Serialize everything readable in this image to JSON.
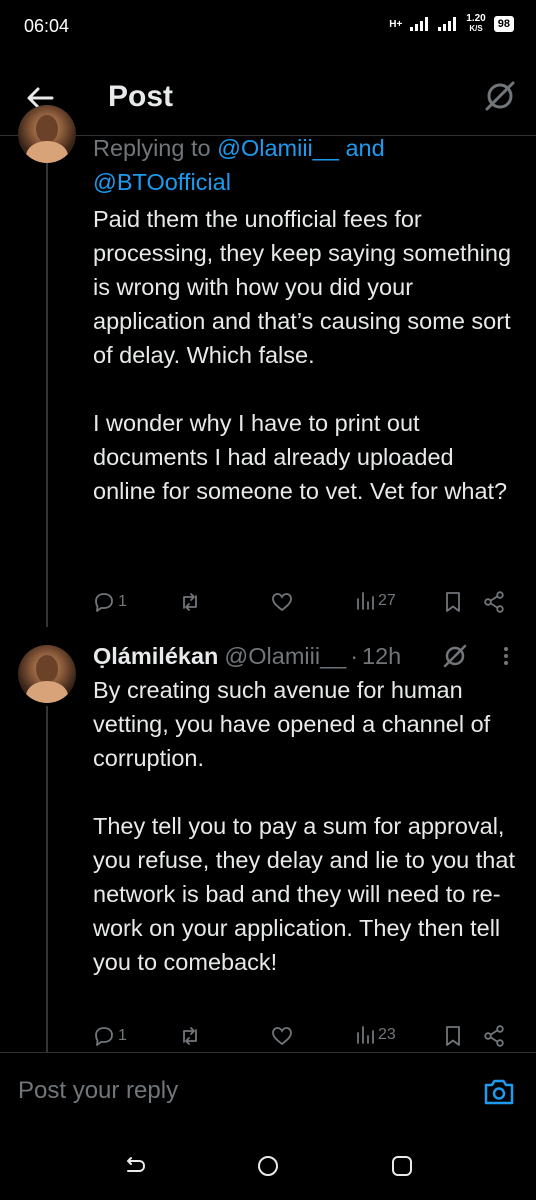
{
  "status_bar": {
    "time": "06:04",
    "network": "H+",
    "net_speed_value": "1.20",
    "net_speed_unit": "K/S",
    "battery": "98"
  },
  "header": {
    "title": "Post",
    "back_icon": "arrow-left-icon",
    "grok_icon": "grok-icon"
  },
  "post1": {
    "reply_to_prefix": "Replying to ",
    "reply_to_user1": "@Olamiii__",
    "reply_to_and": " and",
    "reply_to_user2": "@BTOofficial",
    "text": "Paid them the unofficial fees for processing, they keep saying something is wrong with how you did your application and that’s causing some sort of delay. Which false.\n\nI wonder why I have to print out documents I had already uploaded online for someone to vet. Vet for what?",
    "replies": "1",
    "reposts": "",
    "likes": "",
    "views": "27"
  },
  "post2": {
    "display_name": "Ọlámilékan",
    "handle": "@Olamiii__",
    "separator": "·",
    "time": "12h",
    "text": "By creating such avenue for human vetting, you have opened a channel of corruption.\n\nThey tell you to pay a sum for approval, you refuse, they delay and lie to you that network is bad and they will need to re-work on your application. They then tell you to comeback!",
    "replies": "1",
    "reposts": "",
    "likes": "",
    "views": "23"
  },
  "reply_bar": {
    "placeholder": "Post your reply",
    "camera_icon": "camera-icon"
  },
  "colors": {
    "background": "#000000",
    "text": "#e7e9ea",
    "muted": "#71767b",
    "accent": "#1d9bf0",
    "divider": "#2f3336"
  }
}
